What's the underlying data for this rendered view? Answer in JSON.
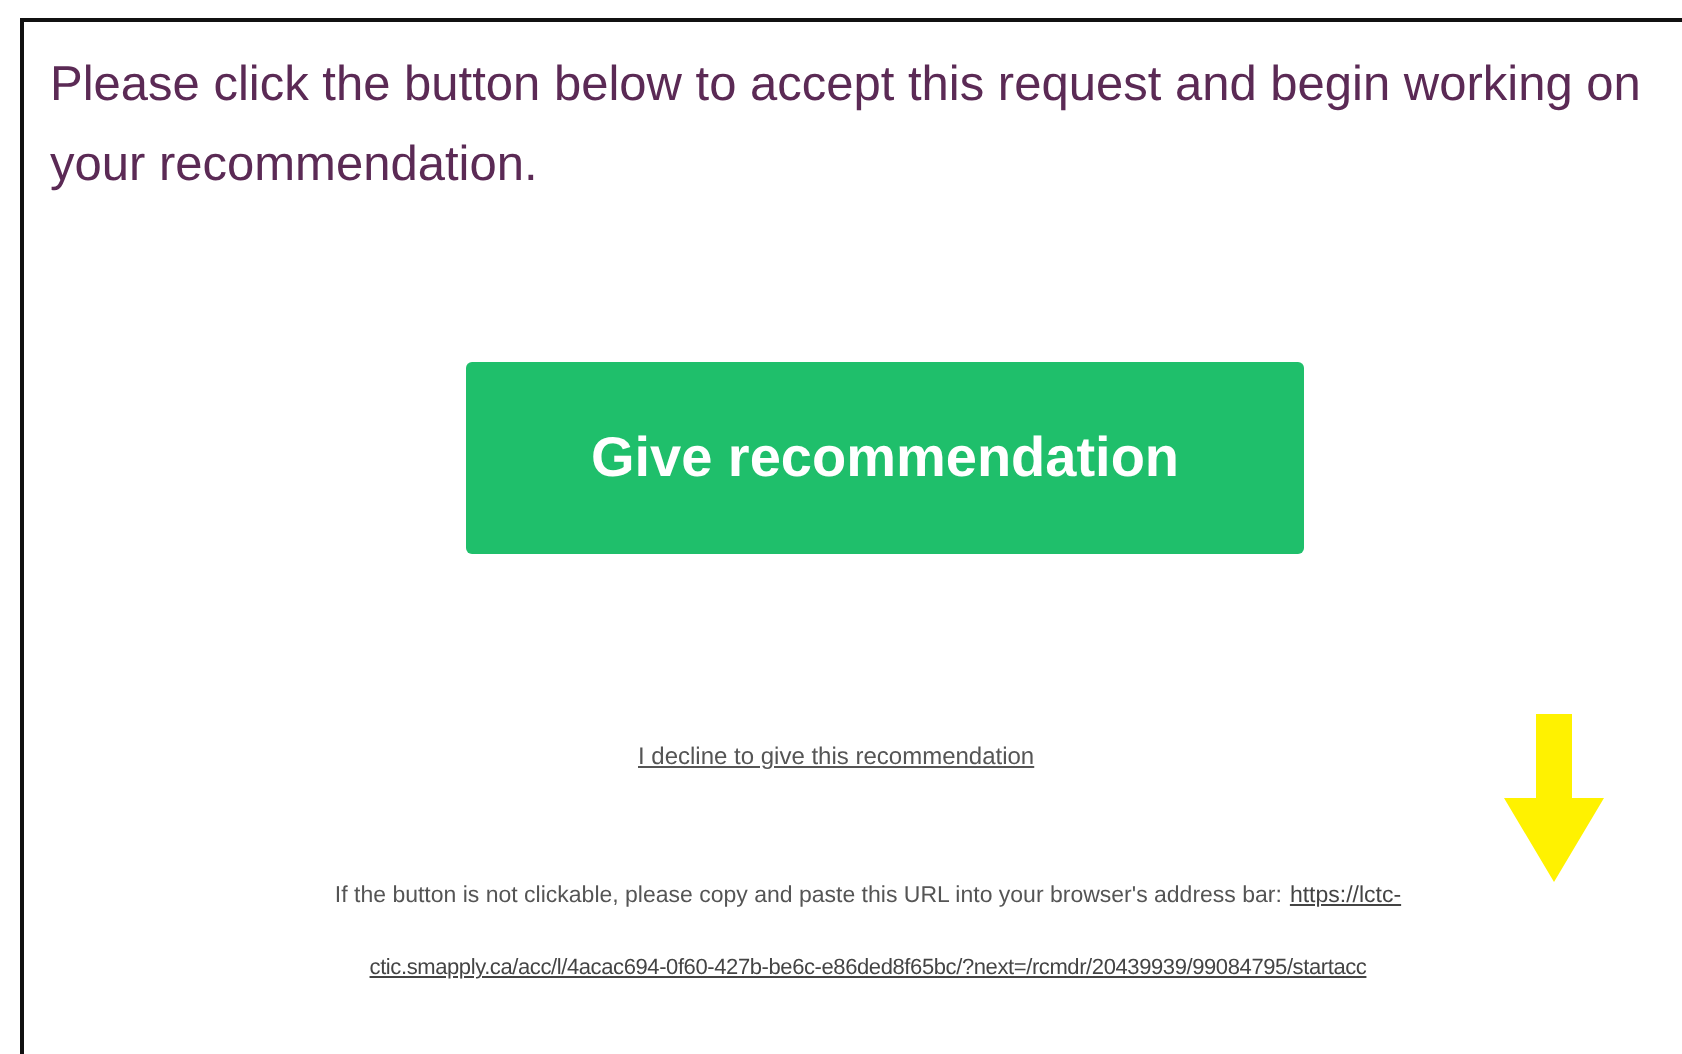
{
  "intro": "Please click the button below to accept this request and begin working on your recommendation.",
  "button": {
    "label": "Give recommendation"
  },
  "decline_link": "I decline to give this recommendation",
  "fallback": {
    "text": "If the button is not clickable, please copy and paste this URL into your browser's address bar:",
    "url_lines": [
      "https://lctc-",
      "ctic.smapply.ca/acc/l/4acac694-0f60-427b-be6c-e86ded8f65bc/?next=/rcmdr/20439939/99084795/startacc"
    ]
  },
  "annotation": {
    "kind": "arrow",
    "color": "#fff200"
  }
}
